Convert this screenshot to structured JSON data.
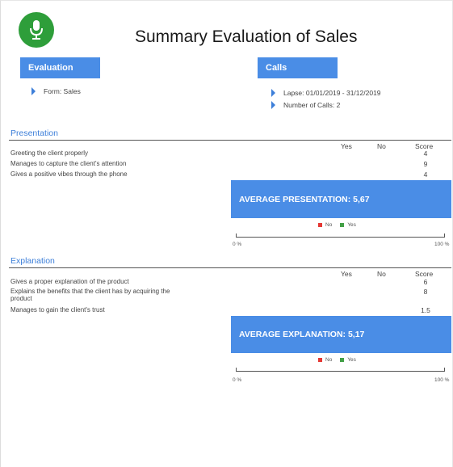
{
  "header": {
    "title": "Summary Evaluation of Sales",
    "logo_icon": "microphone-icon",
    "evaluation_label": "Evaluation",
    "calls_label": "Calls",
    "form": "Form: Sales",
    "lapse": "Lapse: 01/01/2019 - 31/12/2019",
    "num_calls": "Number of Calls: 2"
  },
  "columns": {
    "yes": "Yes",
    "no": "No",
    "score": "Score"
  },
  "sections": [
    {
      "title": "Presentation",
      "rows": [
        {
          "label": "Greeting the client properly",
          "score": "4"
        },
        {
          "label": "Manages to capture the client's attention",
          "score": "9"
        },
        {
          "label": "Gives a positive vibes through the phone",
          "score": "4"
        }
      ],
      "average": "AVERAGE PRESENTATION: 5,67",
      "legend_no": "No",
      "legend_yes": "Yes",
      "axis_min": "0 %",
      "axis_max": "100 %"
    },
    {
      "title": "Explanation",
      "rows": [
        {
          "label": "Gives a proper explanation of the product",
          "score": "6"
        },
        {
          "label": "Explains the benefits that the client has by acquiring the",
          "label2": "product",
          "score": "8"
        },
        {
          "label": "Manages to gain the client's trust",
          "score": "1.5"
        }
      ],
      "average": "AVERAGE EXPLANATION: 5,17",
      "legend_no": "No",
      "legend_yes": "Yes",
      "axis_min": "0 %",
      "axis_max": "100 %"
    }
  ],
  "colors": {
    "accent": "#4a8de6",
    "logo": "#2e9e3a",
    "no": "#e53935",
    "yes": "#43a047"
  }
}
